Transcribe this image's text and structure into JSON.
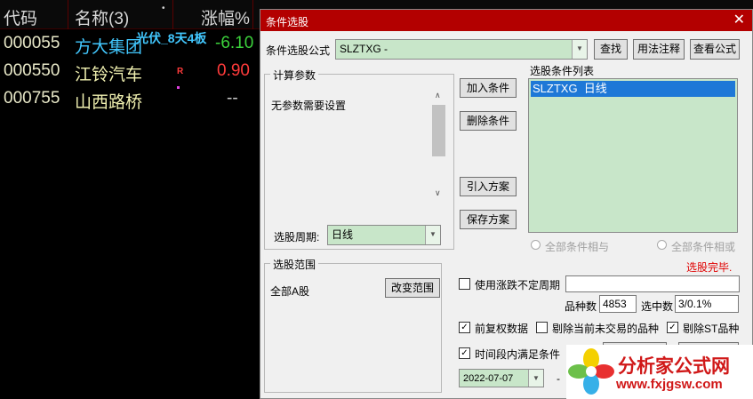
{
  "table": {
    "headers": {
      "code": "代码",
      "name": "名称(3)",
      "dot": "•",
      "change": "涨幅%"
    },
    "rows": [
      {
        "code": "000055",
        "name": "方大集团",
        "tag": "光伏_8天4板",
        "change": "-6.10"
      },
      {
        "code": "000550",
        "name": "江铃汽车",
        "tag": "R",
        "change": "0.90"
      },
      {
        "code": "000755",
        "name": "山西路桥",
        "tag": "",
        "change": "--"
      }
    ]
  },
  "dialog": {
    "title": "条件选股",
    "close": "✕",
    "formula_label": "条件选股公式",
    "formula_value": "SLZTXG        -",
    "btn_find": "查找",
    "btn_usage": "用法注释",
    "btn_view": "查看公式",
    "params_title": "计算参数",
    "params_text": "无参数需要设置",
    "period_label": "选股周期:",
    "period_value": "日线",
    "btn_add": "加入条件",
    "btn_delete": "删除条件",
    "btn_import": "引入方案",
    "btn_save": "保存方案",
    "list_title": "选股条件列表",
    "list_items": [
      "SLZTXG  日线"
    ],
    "radio_and": "全部条件相与",
    "radio_or": "全部条件相或",
    "status": "选股完毕.",
    "range_title": "选股范围",
    "range_value": "全部A股",
    "btn_range": "改变范围",
    "use_period_label": "使用涨跌不定周期",
    "count_label": "品种数",
    "count_value": "4853",
    "selected_label": "选中数",
    "selected_value": "3/0.1%",
    "cb_adjust": "前复权数据",
    "cb_exclude_notrade": "剔除当前未交易的品种",
    "cb_exclude_st": "剔除ST品种",
    "cb_time": "时间段内满足条件",
    "date_value": "2022-07-07",
    "dash": "-"
  },
  "watermark": {
    "text": "分析家公式网",
    "url": "www.fxjgsw.com"
  },
  "colors": {
    "title": "#b30000",
    "listbg": "#c8e6c9",
    "select": "#1e78d7",
    "up": "#ff3b3b",
    "down": "#3cd23c"
  }
}
